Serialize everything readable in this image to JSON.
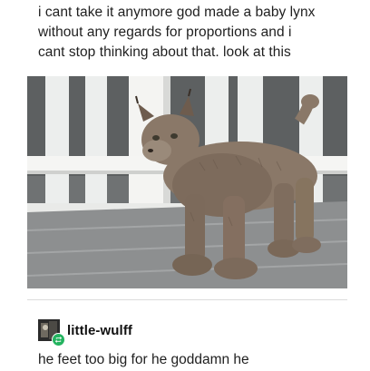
{
  "post": {
    "caption_lines": [
      "i cant take it anymore god made a baby lynx",
      "without any regards for proportions and i",
      "cant stop thinking about that. look at this"
    ]
  },
  "photo": {
    "subject": "wet baby lynx standing on a white wooden porch",
    "colors": {
      "railing": "#f2f2f0",
      "deck": "#8f9192",
      "lynx_fur": "#8a7868"
    }
  },
  "reblog": {
    "username": "little-wulff",
    "avatar_icon": "user-avatar-icon",
    "badge_icon": "reblog-icon",
    "badge_color": "#23b35f",
    "comment": "he feet too big for he goddamn he"
  }
}
